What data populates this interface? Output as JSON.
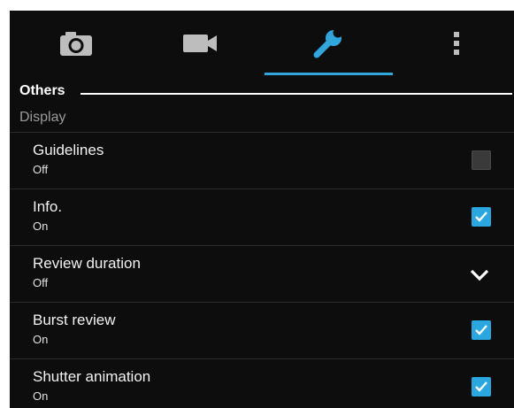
{
  "accent_color": "#2fa6dc",
  "checkbox_on_color": "#29a7e0",
  "tabs": [
    {
      "icon": "camera-icon",
      "selected": false
    },
    {
      "icon": "video-camera-icon",
      "selected": false
    },
    {
      "icon": "wrench-icon",
      "selected": true
    },
    {
      "icon": "more-vert-icon",
      "selected": false
    }
  ],
  "section": {
    "title": "Others"
  },
  "group": {
    "label": "Display"
  },
  "settings": [
    {
      "title": "Guidelines",
      "value": "Off",
      "control": "checkbox",
      "checked": false
    },
    {
      "title": "Info.",
      "value": "On",
      "control": "checkbox",
      "checked": true
    },
    {
      "title": "Review duration",
      "value": "Off",
      "control": "dropdown"
    },
    {
      "title": "Burst review",
      "value": "On",
      "control": "checkbox",
      "checked": true
    },
    {
      "title": "Shutter animation",
      "value": "On",
      "control": "checkbox",
      "checked": true
    }
  ]
}
